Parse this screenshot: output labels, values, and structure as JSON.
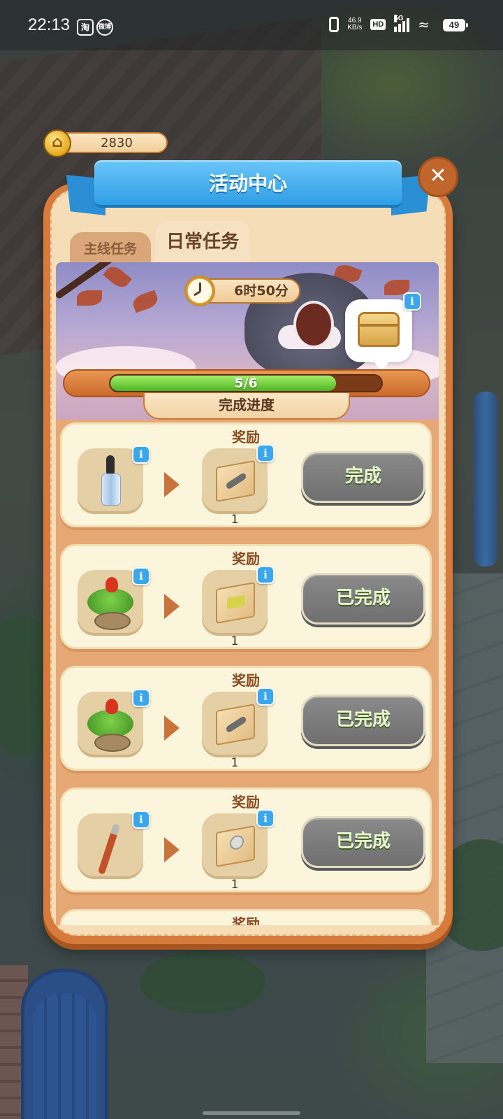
{
  "status_bar": {
    "time": "22:13",
    "app_icons": [
      "淘",
      "微博"
    ],
    "net_speed_value": "46.9",
    "net_speed_unit": "KB/s",
    "hd": "HD",
    "network": "5G",
    "battery": "49"
  },
  "currency": {
    "amount": "2830",
    "icon": "house-coin-icon"
  },
  "panel": {
    "title": "活动中心",
    "close_icon": "close-icon",
    "tabs": [
      {
        "label": "主线任务",
        "active": false
      },
      {
        "label": "日常任务",
        "active": true
      }
    ]
  },
  "hero": {
    "timer": "6时50分",
    "progress": {
      "current": 5,
      "total": 6,
      "text": "5/6",
      "label": "完成进度",
      "fraction": 0.833
    }
  },
  "tasks": [
    {
      "reward_label": "奖励",
      "required_item": "dropper-bottle-icon",
      "reward_item": "toolbox-icon",
      "reward_qty": "1",
      "action": "完成"
    },
    {
      "reward_label": "奖励",
      "required_item": "tulip-pot-icon",
      "reward_item": "soap-box-icon",
      "reward_qty": "1",
      "action": "已完成"
    },
    {
      "reward_label": "奖励",
      "required_item": "tulip-pot-icon",
      "reward_item": "toolbox-icon",
      "reward_qty": "1",
      "action": "已完成"
    },
    {
      "reward_label": "奖励",
      "required_item": "crowbar-icon",
      "reward_item": "knob-box-icon",
      "reward_qty": "1",
      "action": "已完成"
    },
    {
      "reward_label": "奖励"
    }
  ],
  "colors": {
    "panel_orange": "#d77a3c",
    "banner_blue": "#2f9fe6",
    "progress_green": "#4db521",
    "button_gray": "#777777"
  }
}
